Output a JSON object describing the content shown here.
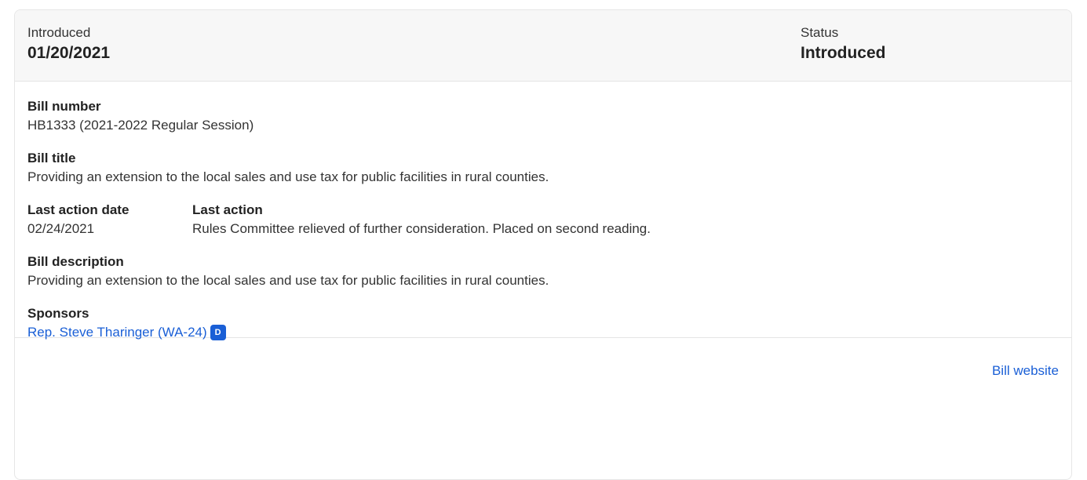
{
  "header": {
    "introduced_label": "Introduced",
    "introduced_date": "01/20/2021",
    "status_label": "Status",
    "status_value": "Introduced"
  },
  "bill": {
    "number_label": "Bill number",
    "number_value": "HB1333 (2021-2022 Regular Session)",
    "title_label": "Bill title",
    "title_value": "Providing an extension to the local sales and use tax for public facilities in rural counties.",
    "last_action_date_label": "Last action date",
    "last_action_date_value": "02/24/2021",
    "last_action_label": "Last action",
    "last_action_value": "Rules Committee relieved of further consideration. Placed on second reading.",
    "description_label": "Bill description",
    "description_value": "Providing an extension to the local sales and use tax for public facilities in rural counties.",
    "sponsors_label": "Sponsors",
    "sponsors": [
      {
        "name": "Rep. Steve Tharinger (WA-24)",
        "party": "D"
      }
    ]
  },
  "footer": {
    "website_label": "Bill website"
  },
  "colors": {
    "link": "#1a5fd6",
    "header_bg": "#f7f7f7",
    "badge_bg": "#1a5fd6"
  }
}
